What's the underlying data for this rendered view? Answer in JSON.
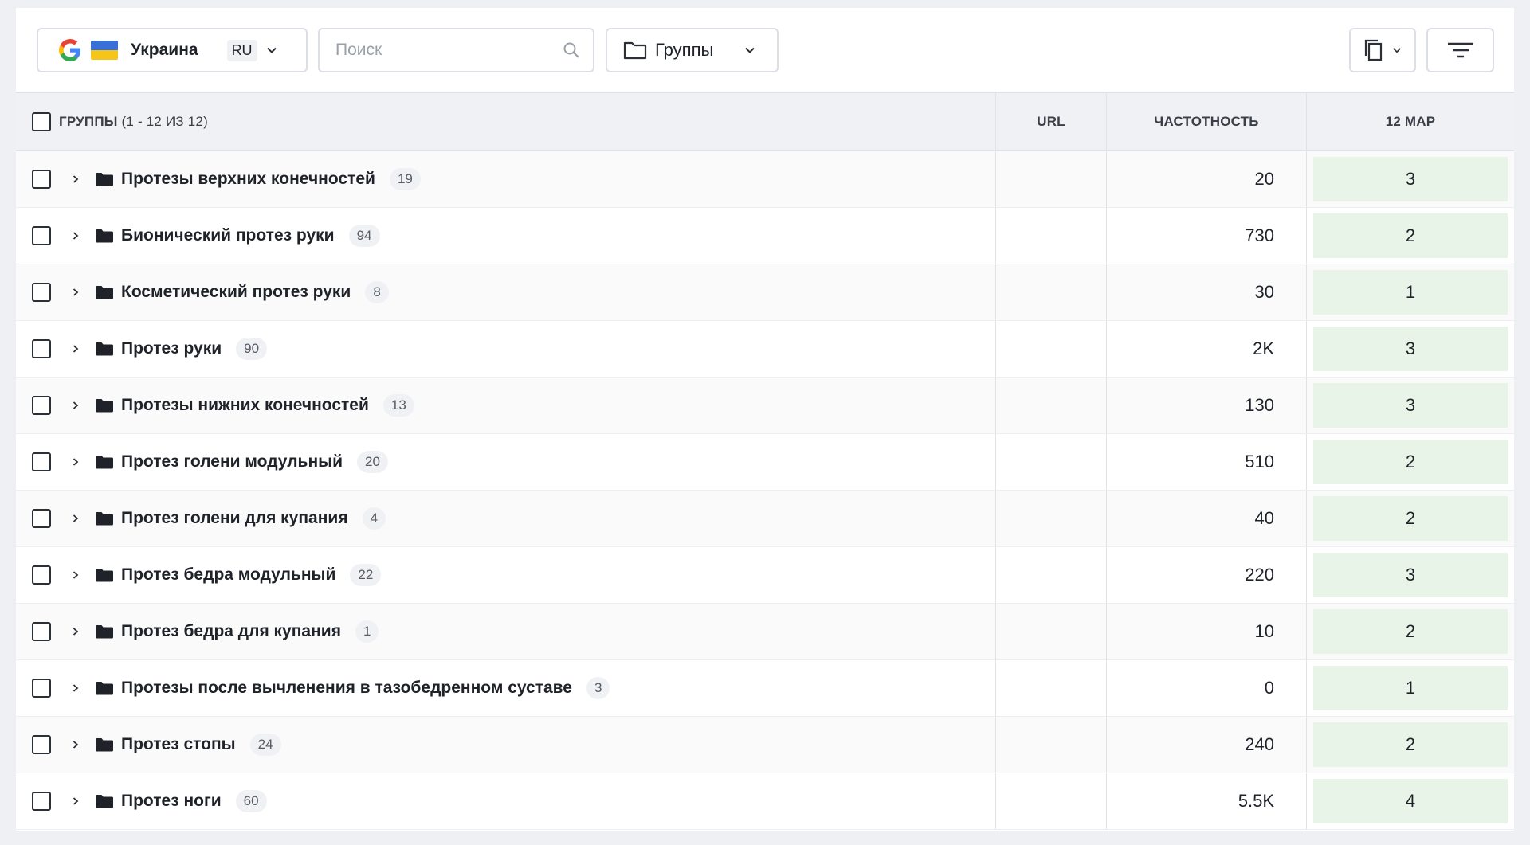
{
  "toolbar": {
    "region": {
      "country": "Украина",
      "lang": "RU",
      "engine_icon": "google-icon"
    },
    "search": {
      "placeholder": "Поиск"
    },
    "groups_select": {
      "label": "Группы"
    },
    "copy_icon": "copy-icon",
    "filter_icon": "filter-icon"
  },
  "table": {
    "header": {
      "name_label": "Группы",
      "name_count": "(1 - 12 из 12)",
      "url_label": "URL",
      "freq_label": "Частотность",
      "date_label": "12 мар"
    },
    "rows": [
      {
        "name": "Протезы верхних конечностей",
        "count": "19",
        "freq": "20",
        "pos": "3"
      },
      {
        "name": "Бионический протез руки",
        "count": "94",
        "freq": "730",
        "pos": "2"
      },
      {
        "name": "Косметический протез руки",
        "count": "8",
        "freq": "30",
        "pos": "1"
      },
      {
        "name": "Протез руки",
        "count": "90",
        "freq": "2K",
        "pos": "3"
      },
      {
        "name": "Протезы нижних конечностей",
        "count": "13",
        "freq": "130",
        "pos": "3"
      },
      {
        "name": "Протез голени модульный",
        "count": "20",
        "freq": "510",
        "pos": "2"
      },
      {
        "name": "Протез голени для купания",
        "count": "4",
        "freq": "40",
        "pos": "2"
      },
      {
        "name": "Протез бедра модульный",
        "count": "22",
        "freq": "220",
        "pos": "3"
      },
      {
        "name": "Протез бедра для купания",
        "count": "1",
        "freq": "10",
        "pos": "2"
      },
      {
        "name": "Протезы после вычленения в тазобедренном суставе",
        "count": "3",
        "freq": "0",
        "pos": "1"
      },
      {
        "name": "Протез стопы",
        "count": "24",
        "freq": "240",
        "pos": "2"
      },
      {
        "name": "Протез ноги",
        "count": "60",
        "freq": "5.5K",
        "pos": "4"
      }
    ]
  },
  "colors": {
    "position_cell": "#e7f4e7",
    "header_bg": "#f0f1f4",
    "page_bg": "#eef0f4"
  }
}
